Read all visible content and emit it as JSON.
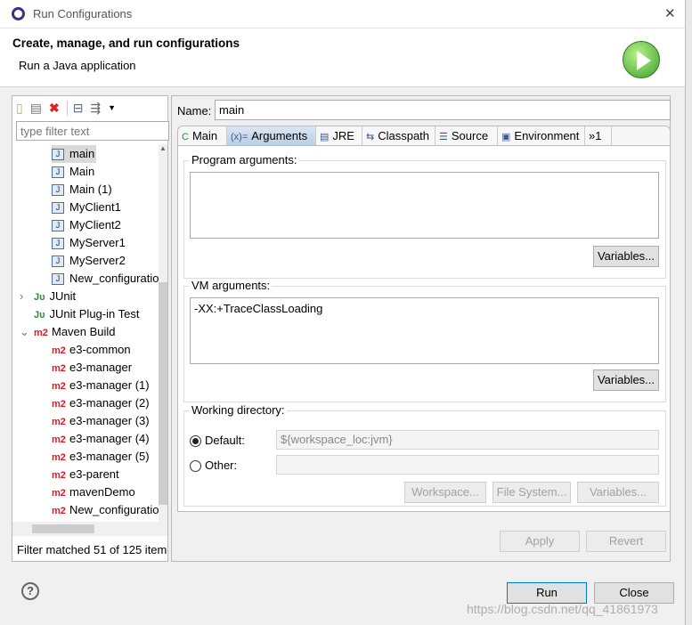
{
  "window": {
    "title": "Run Configurations",
    "close": "✕"
  },
  "header": {
    "title": "Create, manage, and run configurations",
    "subtitle": "Run a Java application",
    "run_icon": "play-icon"
  },
  "left": {
    "toolbar": [
      "new-config-icon",
      "duplicate-icon",
      "delete-icon",
      "collapse-all-icon",
      "filter-icon",
      "dropdown-icon"
    ],
    "filter_placeholder": "type filter text",
    "tree": [
      {
        "label": "main",
        "icon": "J",
        "indent": 2,
        "selected": true
      },
      {
        "label": "Main",
        "icon": "J",
        "indent": 2
      },
      {
        "label": "Main (1)",
        "icon": "J",
        "indent": 2
      },
      {
        "label": "MyClient1",
        "icon": "J",
        "indent": 2
      },
      {
        "label": "MyClient2",
        "icon": "J",
        "indent": 2
      },
      {
        "label": "MyServer1",
        "icon": "J",
        "indent": 2
      },
      {
        "label": "MyServer2",
        "icon": "J",
        "indent": 2
      },
      {
        "label": "New_configuratio",
        "icon": "J",
        "indent": 2
      },
      {
        "label": "JUnit",
        "icon": "JU",
        "indent": 1,
        "expander": "›"
      },
      {
        "label": "JUnit Plug-in Test",
        "icon": "JUP",
        "indent": 1
      },
      {
        "label": "Maven Build",
        "icon": "m2",
        "indent": 1,
        "expander": "⌄"
      },
      {
        "label": "e3-common",
        "icon": "m2",
        "indent": 2
      },
      {
        "label": "e3-manager",
        "icon": "m2",
        "indent": 2
      },
      {
        "label": "e3-manager (1)",
        "icon": "m2",
        "indent": 2
      },
      {
        "label": "e3-manager (2)",
        "icon": "m2",
        "indent": 2
      },
      {
        "label": "e3-manager (3)",
        "icon": "m2",
        "indent": 2
      },
      {
        "label": "e3-manager (4)",
        "icon": "m2",
        "indent": 2
      },
      {
        "label": "e3-manager (5)",
        "icon": "m2",
        "indent": 2
      },
      {
        "label": "e3-parent",
        "icon": "m2",
        "indent": 2
      },
      {
        "label": "mavenDemo",
        "icon": "m2",
        "indent": 2
      },
      {
        "label": "New_configuratio",
        "icon": "m2",
        "indent": 2
      }
    ],
    "status": "Filter matched 51 of 125 item"
  },
  "right": {
    "name_label": "Name:",
    "name_value": "main",
    "tabs": [
      {
        "label": "Main",
        "icon": "C"
      },
      {
        "label": "Arguments",
        "icon": "(x)=",
        "active": true
      },
      {
        "label": "JRE",
        "icon": "▤"
      },
      {
        "label": "Classpath",
        "icon": "⇆"
      },
      {
        "label": "Source",
        "icon": "☰"
      },
      {
        "label": "Environment",
        "icon": "▣"
      },
      {
        "label": "»1",
        "icon": ""
      }
    ],
    "program_args": {
      "label": "Program arguments:",
      "value": "",
      "variables": "Variables..."
    },
    "vm_args": {
      "label": "VM arguments:",
      "value": "-XX:+TraceClassLoading",
      "variables": "Variables..."
    },
    "working_dir": {
      "label": "Working directory:",
      "default_label": "Default:",
      "default_value": "${workspace_loc:jvm}",
      "other_label": "Other:",
      "other_value": "",
      "workspace": "Workspace...",
      "filesystem": "File System...",
      "variables": "Variables..."
    },
    "apply": "Apply",
    "revert": "Revert"
  },
  "footer": {
    "help": "?",
    "run": "Run",
    "close": "Close",
    "watermark": "https://blog.csdn.net/qq_41861973"
  }
}
